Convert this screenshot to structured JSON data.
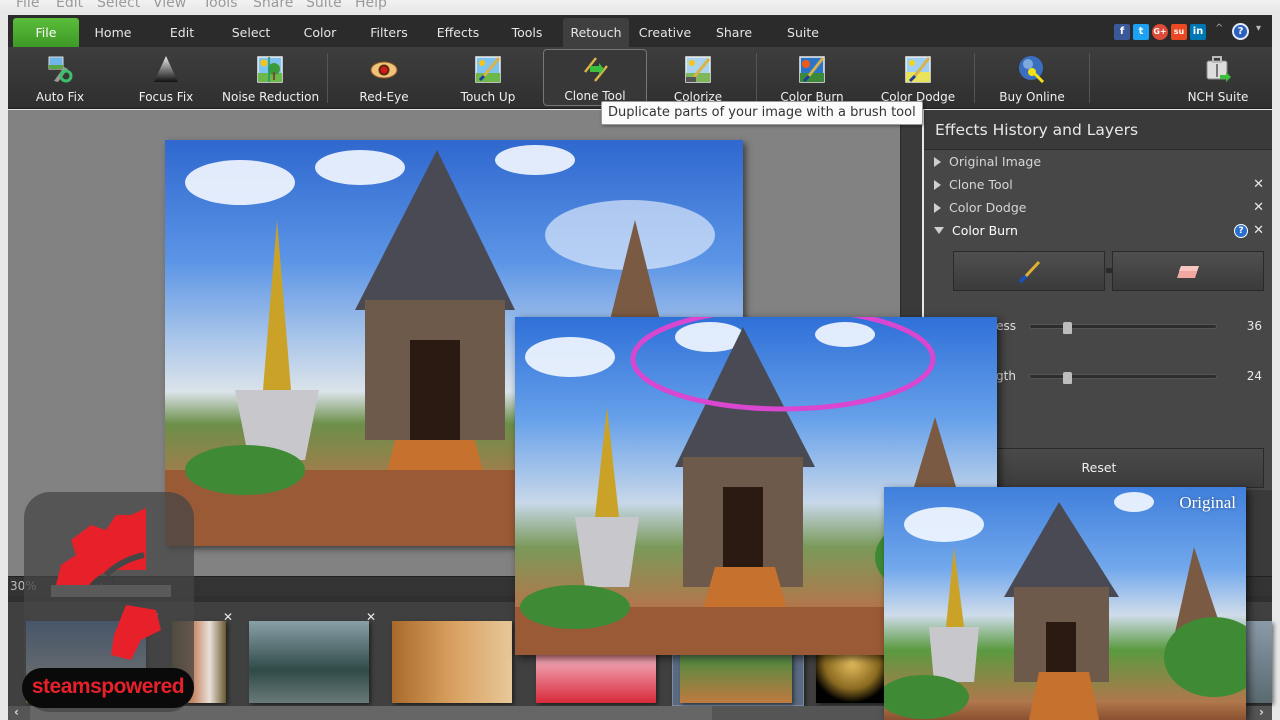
{
  "menubar": {
    "items": [
      "File",
      "Edit",
      "Select",
      "View",
      "Tools",
      "Share",
      "Suite",
      "Help"
    ]
  },
  "tabs": [
    {
      "label": "File",
      "state": "file"
    },
    {
      "label": "Home"
    },
    {
      "label": "Edit"
    },
    {
      "label": "Select"
    },
    {
      "label": "Color"
    },
    {
      "label": "Filters"
    },
    {
      "label": "Effects"
    },
    {
      "label": "Tools"
    },
    {
      "label": "Retouch",
      "state": "active"
    },
    {
      "label": "Creative"
    },
    {
      "label": "Share"
    },
    {
      "label": "Suite"
    }
  ],
  "social": [
    {
      "icon": "facebook-icon",
      "glyph": "f",
      "color": "#3b5998"
    },
    {
      "icon": "twitter-icon",
      "glyph": "t",
      "color": "#1da1f2"
    },
    {
      "icon": "google-plus-icon",
      "glyph": "G+",
      "color": "#dd4b39"
    },
    {
      "icon": "stumbleupon-icon",
      "glyph": "su",
      "color": "#eb4924"
    },
    {
      "icon": "linkedin-icon",
      "glyph": "in",
      "color": "#0077b5"
    }
  ],
  "help": {
    "caret_up": "^",
    "help_glyph": "?",
    "caret_down": "▾"
  },
  "toolbar": {
    "buttons": [
      {
        "label": "Auto Fix",
        "icon": "auto-fix-icon"
      },
      {
        "label": "Focus Fix",
        "icon": "focus-fix-icon"
      },
      {
        "label": "Noise Reduction",
        "icon": "noise-reduction-icon"
      },
      {
        "label": "Red-Eye",
        "icon": "red-eye-icon"
      },
      {
        "label": "Touch Up",
        "icon": "touch-up-icon"
      },
      {
        "label": "Clone Tool",
        "icon": "clone-tool-icon",
        "selected": true
      },
      {
        "label": "Colorize",
        "icon": "colorize-icon"
      },
      {
        "label": "Color Burn",
        "icon": "color-burn-icon"
      },
      {
        "label": "Color Dodge",
        "icon": "color-dodge-icon"
      },
      {
        "label": "Buy Online",
        "icon": "buy-online-icon"
      },
      {
        "label": "NCH Suite",
        "icon": "nch-suite-icon"
      }
    ]
  },
  "tooltip": "Duplicate parts of your image with a brush tool",
  "panel": {
    "title": "Effects History and Layers",
    "history": [
      {
        "label": "Original Image",
        "expanded": false,
        "removable": false
      },
      {
        "label": "Clone Tool",
        "expanded": false,
        "removable": true
      },
      {
        "label": "Color Dodge",
        "expanded": false,
        "removable": true
      },
      {
        "label": "Color Burn",
        "expanded": true,
        "removable": true,
        "help": true
      }
    ],
    "close_glyph": "✕",
    "sliders": [
      {
        "label": "Softness",
        "visible_label": "ess",
        "value": "36",
        "fraction": 0.2
      },
      {
        "label": "Strength",
        "visible_label": "gth",
        "value": "24",
        "fraction": 0.2
      }
    ],
    "reset_label": "Reset"
  },
  "statusbar": {
    "zoom": "30%",
    "buttons": [
      "−",
      "+",
      "‹"
    ]
  },
  "filmstrip": {
    "thumbnails": [
      {
        "name": "golden-buddha-sky"
      },
      {
        "name": "karen-woman"
      },
      {
        "name": "tuk-tuk-taxi"
      },
      {
        "name": "tiger"
      },
      {
        "name": "rose-petals"
      },
      {
        "name": "temple-steps",
        "selected": true
      },
      {
        "name": "golden-statue"
      },
      {
        "name": "motorbike"
      }
    ],
    "close_glyph": "✕",
    "scroll_left": "‹",
    "scroll_right": "›"
  },
  "preview": {
    "original_label": "Original"
  },
  "watermark": {
    "text": "steamspowered"
  },
  "colors": {
    "file_tab": "#4caf2f",
    "accent_ellipse": "#d946d0",
    "watermark_red": "#e8202a"
  }
}
